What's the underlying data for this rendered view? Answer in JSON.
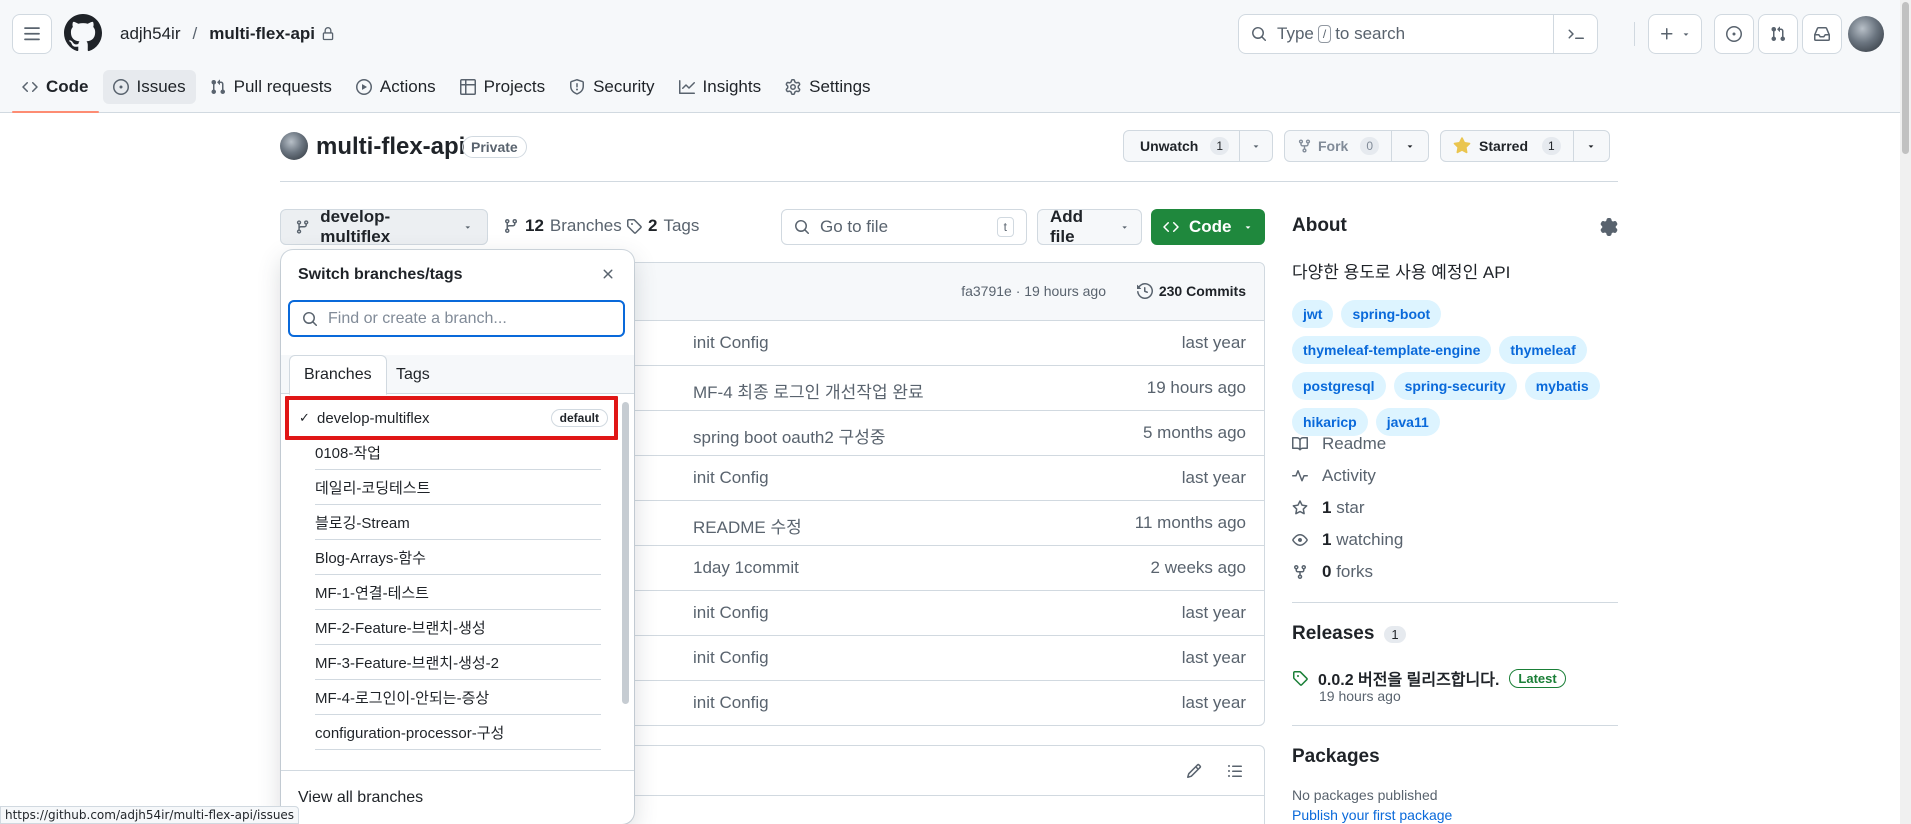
{
  "header": {
    "owner": "adjh54ir",
    "separator": "/",
    "repo": "multi-flex-api",
    "search": {
      "prefix": "Type",
      "key": "/",
      "suffix": "to search"
    }
  },
  "repo_nav": [
    {
      "label": "Code",
      "icon": "code-icon"
    },
    {
      "label": "Issues",
      "icon": "issue-icon"
    },
    {
      "label": "Pull requests",
      "icon": "pull-request-icon"
    },
    {
      "label": "Actions",
      "icon": "play-icon"
    },
    {
      "label": "Projects",
      "icon": "table-icon"
    },
    {
      "label": "Security",
      "icon": "shield-icon"
    },
    {
      "label": "Insights",
      "icon": "graph-icon"
    },
    {
      "label": "Settings",
      "icon": "gear-icon"
    }
  ],
  "repo": {
    "title": "multi-flex-api",
    "visibility": "Private",
    "watch": {
      "label": "Unwatch",
      "count": "1"
    },
    "fork": {
      "label": "Fork",
      "count": "0"
    },
    "star": {
      "label": "Starred",
      "count": "1"
    }
  },
  "branch_bar": {
    "current_branch": "develop-multiflex",
    "branches_count": "12",
    "branches_label": "Branches",
    "tags_count": "2",
    "tags_label": "Tags",
    "goto_placeholder": "Go to file",
    "goto_key": "t",
    "add_file": "Add file",
    "code": "Code"
  },
  "file_table": {
    "latest_hash": "fa3791e · 19 hours ago",
    "commits": "230 Commits",
    "rows": [
      {
        "message": "init Config",
        "time": "last year"
      },
      {
        "message": "MF-4 최종 로그인 개선작업 완료",
        "time": "19 hours ago"
      },
      {
        "message": "spring boot oauth2 구성중",
        "time": "5 months ago"
      },
      {
        "message": "init Config",
        "time": "last year"
      },
      {
        "message": "README 수정",
        "time": "11 months ago"
      },
      {
        "message": "1day 1commit",
        "time": "2 weeks ago"
      },
      {
        "message": "init Config",
        "time": "last year"
      },
      {
        "message": "init Config",
        "time": "last year"
      },
      {
        "message": "init Config",
        "time": "last year"
      }
    ]
  },
  "about": {
    "heading": "About",
    "description": "다양한 용도로 사용 예정인 API",
    "topics": [
      "jwt",
      "spring-boot",
      "thymeleaf-template-engine",
      "thymeleaf",
      "postgresql",
      "spring-security",
      "mybatis",
      "hikaricp",
      "java11"
    ],
    "links": [
      {
        "icon": "book-icon",
        "count": "",
        "label": "Readme"
      },
      {
        "icon": "pulse-icon",
        "count": "",
        "label": "Activity"
      },
      {
        "icon": "star-icon",
        "count": "1",
        "label": "star"
      },
      {
        "icon": "eye-icon",
        "count": "1",
        "label": "watching"
      },
      {
        "icon": "fork-icon",
        "count": "0",
        "label": "forks"
      }
    ]
  },
  "releases": {
    "heading": "Releases",
    "count": "1",
    "latest_title": "0.0.2 버전을 릴리즈합니다.",
    "latest_badge": "Latest",
    "latest_time": "19 hours ago"
  },
  "packages": {
    "heading": "Packages",
    "none_text": "No packages published",
    "publish_link": "Publish your first package"
  },
  "branch_dropdown": {
    "title": "Switch branches/tags",
    "filter_placeholder": "Find or create a branch...",
    "tabs": [
      "Branches",
      "Tags"
    ],
    "selected": {
      "name": "develop-multiflex",
      "badge": "default"
    },
    "branches": [
      "0108-작업",
      "데일리-코딩테스트",
      "블로깅-Stream",
      "Blog-Arrays-함수",
      "MF-1-연결-테스트",
      "MF-2-Feature-브랜치-생성",
      "MF-3-Feature-브랜치-생성-2",
      "MF-4-로그인이-안되는-증상",
      "configuration-processor-구성"
    ],
    "footer": "View all branches"
  },
  "status_url": "https://github.com/adjh54ir/multi-flex-api/issues",
  "colors": {
    "accent": "#0969da",
    "primary_button": "#1f883d",
    "nav_underline": "#fd8c73",
    "highlight_box": "#e01616"
  }
}
